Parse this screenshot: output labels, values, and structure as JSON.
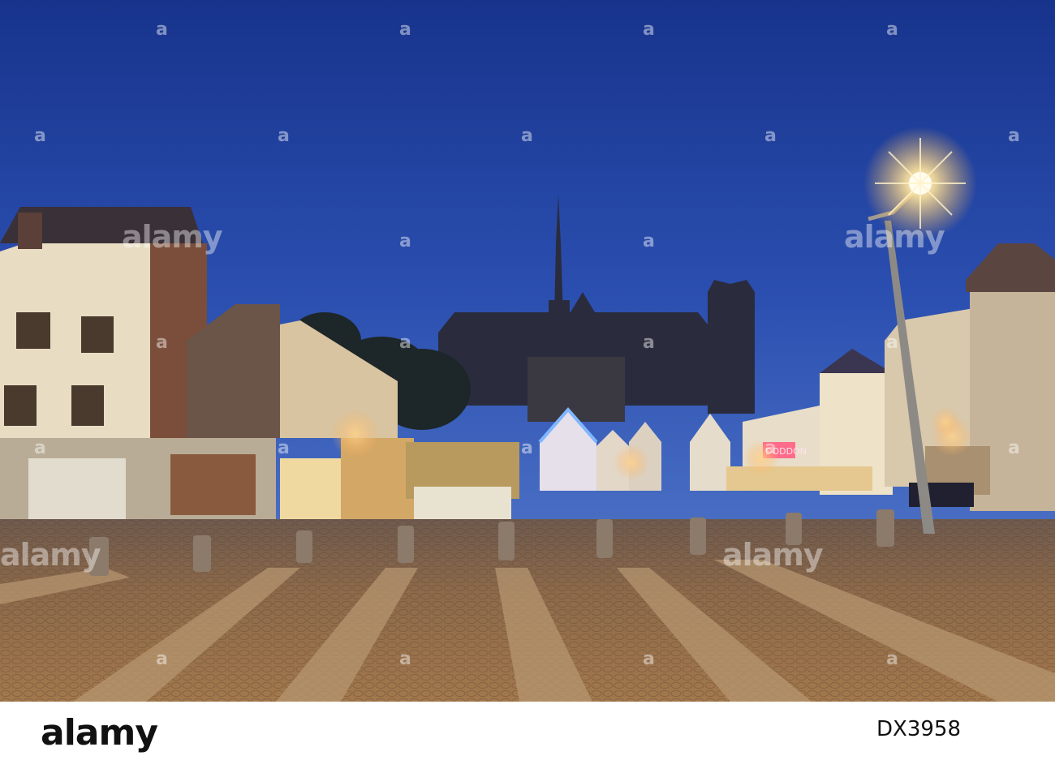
{
  "photo": {
    "sky_top": "#1d3a94",
    "sky_bottom": "#3f66c2",
    "pavement": "#8a6646",
    "streetlight_glow": "#ffe9a8",
    "shop_sign": "DODDON"
  },
  "watermark": {
    "text": "alamy"
  },
  "footer": {
    "brand": "alamy",
    "image_id": "DX3958"
  }
}
